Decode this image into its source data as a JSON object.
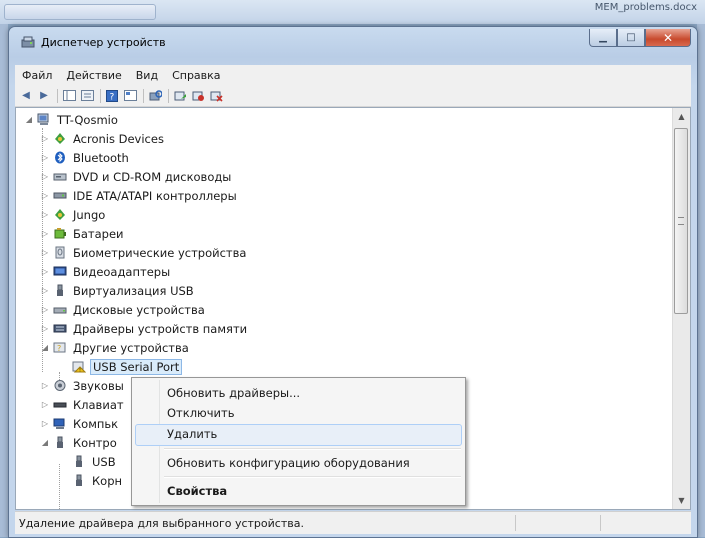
{
  "background": {
    "doc_title": "MEM_problems.docx"
  },
  "window": {
    "title": "Диспетчер устройств",
    "close_glyph": "✕",
    "min_glyph": "▁",
    "max_glyph": "□"
  },
  "menu": [
    "Файл",
    "Действие",
    "Вид",
    "Справка"
  ],
  "toolbar_icons": [
    "back-icon",
    "forward-icon",
    "show-hide-tree-icon",
    "properties-icon",
    "help-icon",
    "view-icon",
    "scan-hardware-icon",
    "update-driver-icon",
    "disable-icon",
    "uninstall-icon"
  ],
  "tree": {
    "root": "TT-Qosmio",
    "categories": [
      {
        "label": "Acronis Devices",
        "icon": "acronis-icon"
      },
      {
        "label": "Bluetooth",
        "icon": "bluetooth-icon"
      },
      {
        "label": "DVD и CD-ROM дисководы",
        "icon": "dvd-drive-icon"
      },
      {
        "label": "IDE ATA/ATAPI контроллеры",
        "icon": "ide-controller-icon"
      },
      {
        "label": "Jungo",
        "icon": "jungo-icon"
      },
      {
        "label": "Батареи",
        "icon": "battery-icon"
      },
      {
        "label": "Биометрические устройства",
        "icon": "biometric-icon"
      },
      {
        "label": "Видеоадаптеры",
        "icon": "display-adapter-icon"
      },
      {
        "label": "Виртуализация USB",
        "icon": "usb-icon"
      },
      {
        "label": "Дисковые устройства",
        "icon": "disk-drive-icon"
      },
      {
        "label": "Драйверы устройств памяти",
        "icon": "memory-driver-icon"
      },
      {
        "label": "Другие устройства",
        "icon": "other-devices-icon"
      },
      {
        "label": "USB Serial Port",
        "icon": "unknown-device-icon"
      },
      {
        "label": "Звуковы",
        "icon": "sound-icon"
      },
      {
        "label": "Клавиат",
        "icon": "keyboard-icon"
      },
      {
        "label": "Компьк",
        "icon": "computer-icon"
      },
      {
        "label": "Контро",
        "icon": "usb-controller-icon"
      },
      {
        "label": "USB",
        "icon": "usb-icon"
      },
      {
        "label": "Корн",
        "icon": "usb-icon"
      }
    ]
  },
  "context_menu": {
    "items": [
      "Обновить драйверы...",
      "Отключить",
      "Удалить",
      "Обновить конфигурацию оборудования",
      "Свойства"
    ],
    "highlighted": "Удалить"
  },
  "status_bar": {
    "text": "Удаление драйвера для выбранного устройства."
  },
  "colors": {
    "selection": "#d9ebfa",
    "menu_highlight": "#e8eff8",
    "close_button": "#c84a2d"
  }
}
